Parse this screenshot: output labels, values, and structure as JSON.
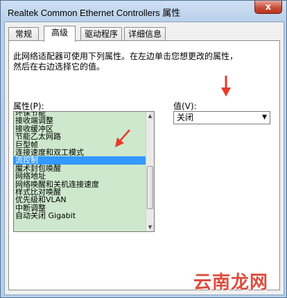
{
  "window": {
    "title": "Realtek Common Ethernet Controllers 属性",
    "close_glyph": "x"
  },
  "tabs": [
    {
      "label": "常规"
    },
    {
      "label": "高级"
    },
    {
      "label": "驱动程序"
    },
    {
      "label": "详细信息"
    }
  ],
  "panel": {
    "description": "此网络适配器可使用下列属性。在左边单击您想更改的属性，\n然后在右边选择它的值。",
    "property_label": "属性(P):",
    "value_label": "值(V):"
  },
  "properties": [
    "环保节能",
    "接收端调整",
    "接收缓冲区",
    "节能乙太网路",
    "巨型帧",
    "连接速度和双工模式",
    "流控制",
    "魔术封包唤醒",
    "网络地址",
    "网络唤醒和关机连接速度",
    "样式比对唤醒",
    "优先级和VLAN",
    "中断调整",
    "自动关闭 Gigabit"
  ],
  "selected_property": "流控制",
  "value": {
    "selected": "关闭"
  },
  "watermark": "云南龙网",
  "colors": {
    "selection": "#3399ff",
    "list_background": "#cde8cd",
    "annotation_arrow": "#e83a2a"
  },
  "icons": {
    "close": "close-icon",
    "dropdown": "chevron-down-icon",
    "scroll_up": "scroll-up-icon",
    "scroll_down": "scroll-down-icon",
    "arrow": "red-arrow-annotation"
  }
}
